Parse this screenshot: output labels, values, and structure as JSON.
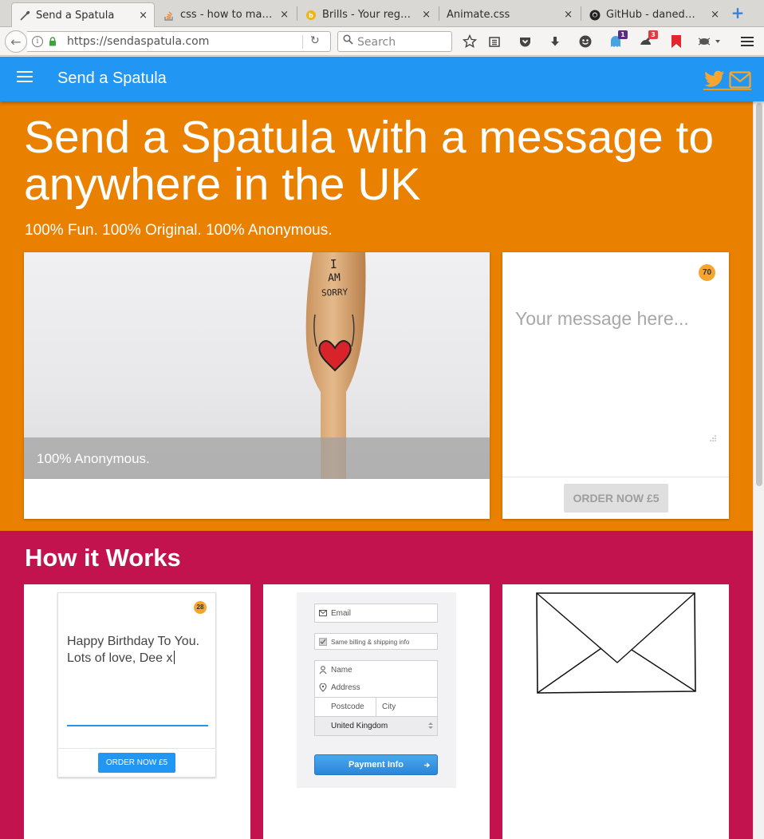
{
  "browser": {
    "tabs": [
      {
        "title": "Send a Spatula",
        "favicon": "spatula-icon"
      },
      {
        "title": "css - how to ma…",
        "favicon": "stackoverflow-icon"
      },
      {
        "title": "Brills - Your reg…",
        "favicon": "brills-icon"
      },
      {
        "title": "Animate.css",
        "favicon": "blank-icon"
      },
      {
        "title": "GitHub - daned…",
        "favicon": "github-icon"
      }
    ],
    "close_glyph": "×",
    "new_tab_glyph": "+",
    "url": "https://sendaspatula.com",
    "search_placeholder": "Search",
    "badges": {
      "extension_one": "1",
      "extension_two": "3"
    }
  },
  "header": {
    "title": "Send a Spatula",
    "accent_color": "#2196f3"
  },
  "hero": {
    "headline": "Send a Spatula with a message to anywhere in the UK",
    "tagline": "100% Fun. 100% Original. 100% Anonymous.",
    "image_caption": "100% Anonymous.",
    "spatula_text": [
      "I",
      "AM",
      "SORRY"
    ],
    "background_color": "#e98000",
    "message": {
      "placeholder": "Your message here...",
      "char_count": "70",
      "order_label": "ORDER NOW £5"
    }
  },
  "how": {
    "title": "How it Works",
    "background_color": "#c2134e",
    "step1": {
      "char_count": "28",
      "message": "Happy Birthday To You. Lots of love, Dee x",
      "order_label": "ORDER NOW £5"
    },
    "step2": {
      "email": "Email",
      "same_billing": "Same billing & shipping info",
      "name": "Name",
      "address": "Address",
      "postcode": "Postcode",
      "city": "City",
      "country": "United Kingdom",
      "payment_label": "Payment Info"
    }
  }
}
